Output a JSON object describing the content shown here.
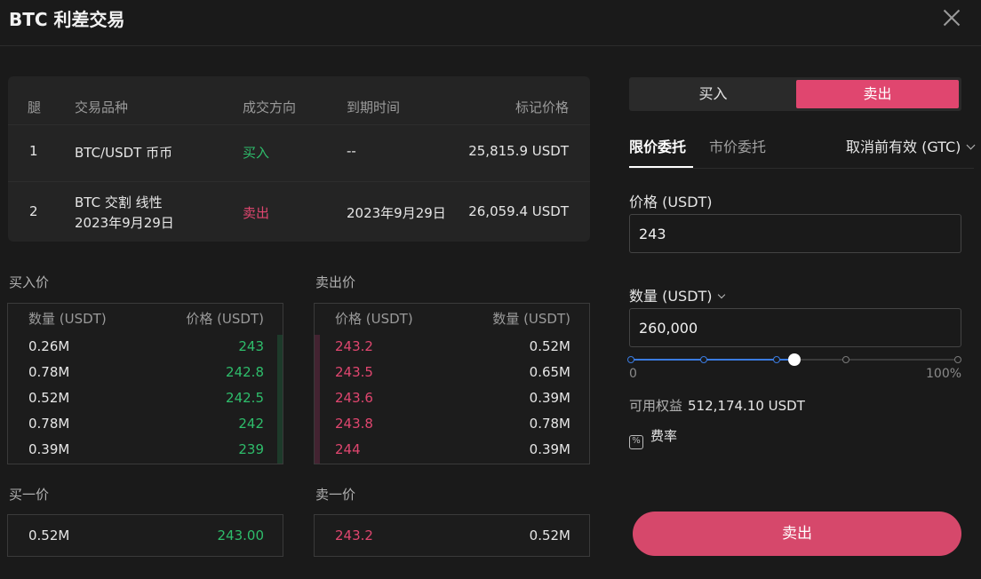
{
  "dialog": {
    "title": "BTC 利差交易"
  },
  "legs": {
    "headers": {
      "leg": "腿",
      "instrument": "交易品种",
      "direction": "成交方向",
      "expiry": "到期时间",
      "mark_price": "标记价格"
    },
    "rows": [
      {
        "leg": "1",
        "instrument_line1": "BTC/USDT 币币",
        "instrument_line2": "",
        "direction": "买入",
        "expiry": "--",
        "mark_price": "25,815.9 USDT"
      },
      {
        "leg": "2",
        "instrument_line1": "BTC 交割 线性",
        "instrument_line2": "2023年9月29日",
        "direction": "卖出",
        "expiry": "2023年9月29日",
        "mark_price": "26,059.4 USDT"
      }
    ]
  },
  "bids": {
    "label": "买入价",
    "qty_header": "数量 (USDT)",
    "price_header": "价格 (USDT)",
    "rows": [
      {
        "qty": "0.26M",
        "price": "243"
      },
      {
        "qty": "0.78M",
        "price": "242.8"
      },
      {
        "qty": "0.52M",
        "price": "242.5"
      },
      {
        "qty": "0.78M",
        "price": "242"
      },
      {
        "qty": "0.39M",
        "price": "239"
      }
    ]
  },
  "asks": {
    "label": "卖出价",
    "price_header": "价格 (USDT)",
    "qty_header": "数量 (USDT)",
    "rows": [
      {
        "price": "243.2",
        "qty": "0.52M"
      },
      {
        "price": "243.5",
        "qty": "0.65M"
      },
      {
        "price": "243.6",
        "qty": "0.39M"
      },
      {
        "price": "243.8",
        "qty": "0.78M"
      },
      {
        "price": "244",
        "qty": "0.39M"
      }
    ]
  },
  "best_bid": {
    "label": "买一价",
    "qty": "0.52M",
    "price": "243.00"
  },
  "best_ask": {
    "label": "卖一价",
    "price": "243.2",
    "qty": "0.52M"
  },
  "order": {
    "side_buy": "买入",
    "side_sell": "卖出",
    "selected_side": "sell",
    "tab_limit": "限价委托",
    "tab_market": "市价委托",
    "time_in_force": "取消前有效 (GTC)",
    "price_label": "价格 (USDT)",
    "price_value": "243",
    "qty_label": "数量 (USDT)",
    "qty_value": "260,000",
    "slider_min": "0",
    "slider_max": "100%",
    "slider_level_percent": 50,
    "available_label": "可用权益",
    "available_value": "512,174.10 USDT",
    "fee_label": "费率",
    "submit_label": "卖出"
  },
  "colors": {
    "buy": "#2ebd6b",
    "sell": "#e0466f",
    "submit": "#d6486b",
    "slider": "#3a7be0"
  }
}
